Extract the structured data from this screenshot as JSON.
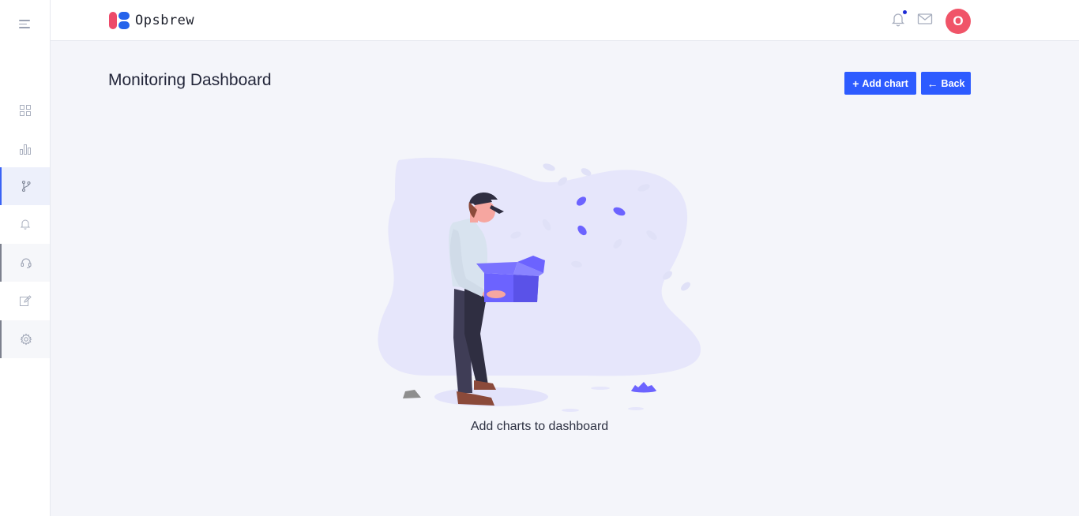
{
  "app": {
    "brand_name": "Opsbrew"
  },
  "header": {
    "avatar_initial": "O"
  },
  "sidebar": {
    "items": [
      {
        "name": "dashboard",
        "icon": "grid-icon"
      },
      {
        "name": "analytics",
        "icon": "bar-chart-icon"
      },
      {
        "name": "pipelines",
        "icon": "git-branch-icon",
        "active": true
      },
      {
        "name": "alerts",
        "icon": "bell-icon"
      },
      {
        "name": "support",
        "icon": "headset-icon"
      },
      {
        "name": "editor",
        "icon": "edit-icon"
      },
      {
        "name": "settings",
        "icon": "gear-icon"
      }
    ]
  },
  "main": {
    "title": "Monitoring Dashboard",
    "add_chart_label": "Add chart",
    "back_label": "Back",
    "empty_state_text": "Add charts to dashboard"
  },
  "colors": {
    "accent": "#2d5bff",
    "avatar": "#f05468",
    "illustration_primary": "#6c63ff",
    "background": "#f4f5fa"
  }
}
